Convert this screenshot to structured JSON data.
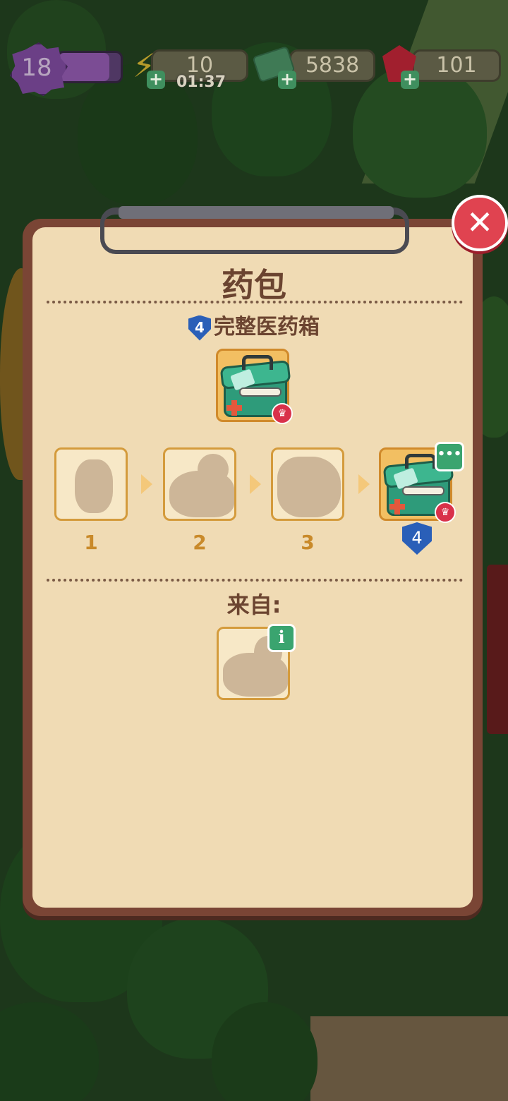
{
  "hud": {
    "level": "18",
    "xp_progress": 0.82,
    "energy": "10",
    "energy_timer": "01:37",
    "cash": "5838",
    "gems": "101"
  },
  "dialog": {
    "title": "药包",
    "item_name": "完整医药箱",
    "item_level": "4",
    "chain_steps": [
      "1",
      "2",
      "3"
    ],
    "final_level": "4",
    "from_label": "来自:",
    "close_symbol": "✕"
  },
  "icons": {
    "more": "more-options-icon",
    "info": "info-icon",
    "crown": "crown-icon",
    "energy": "lightning-bolt-icon",
    "cash": "cash-icon",
    "gem": "ruby-gem-icon"
  },
  "colors": {
    "panel_frame": "#7a4535",
    "panel_paper": "#f0dbb4",
    "slot_gold": "#f2bf62",
    "close_red": "#e04350",
    "shield_blue": "#2a5fb8",
    "kit_green": "#2e9b7a"
  }
}
